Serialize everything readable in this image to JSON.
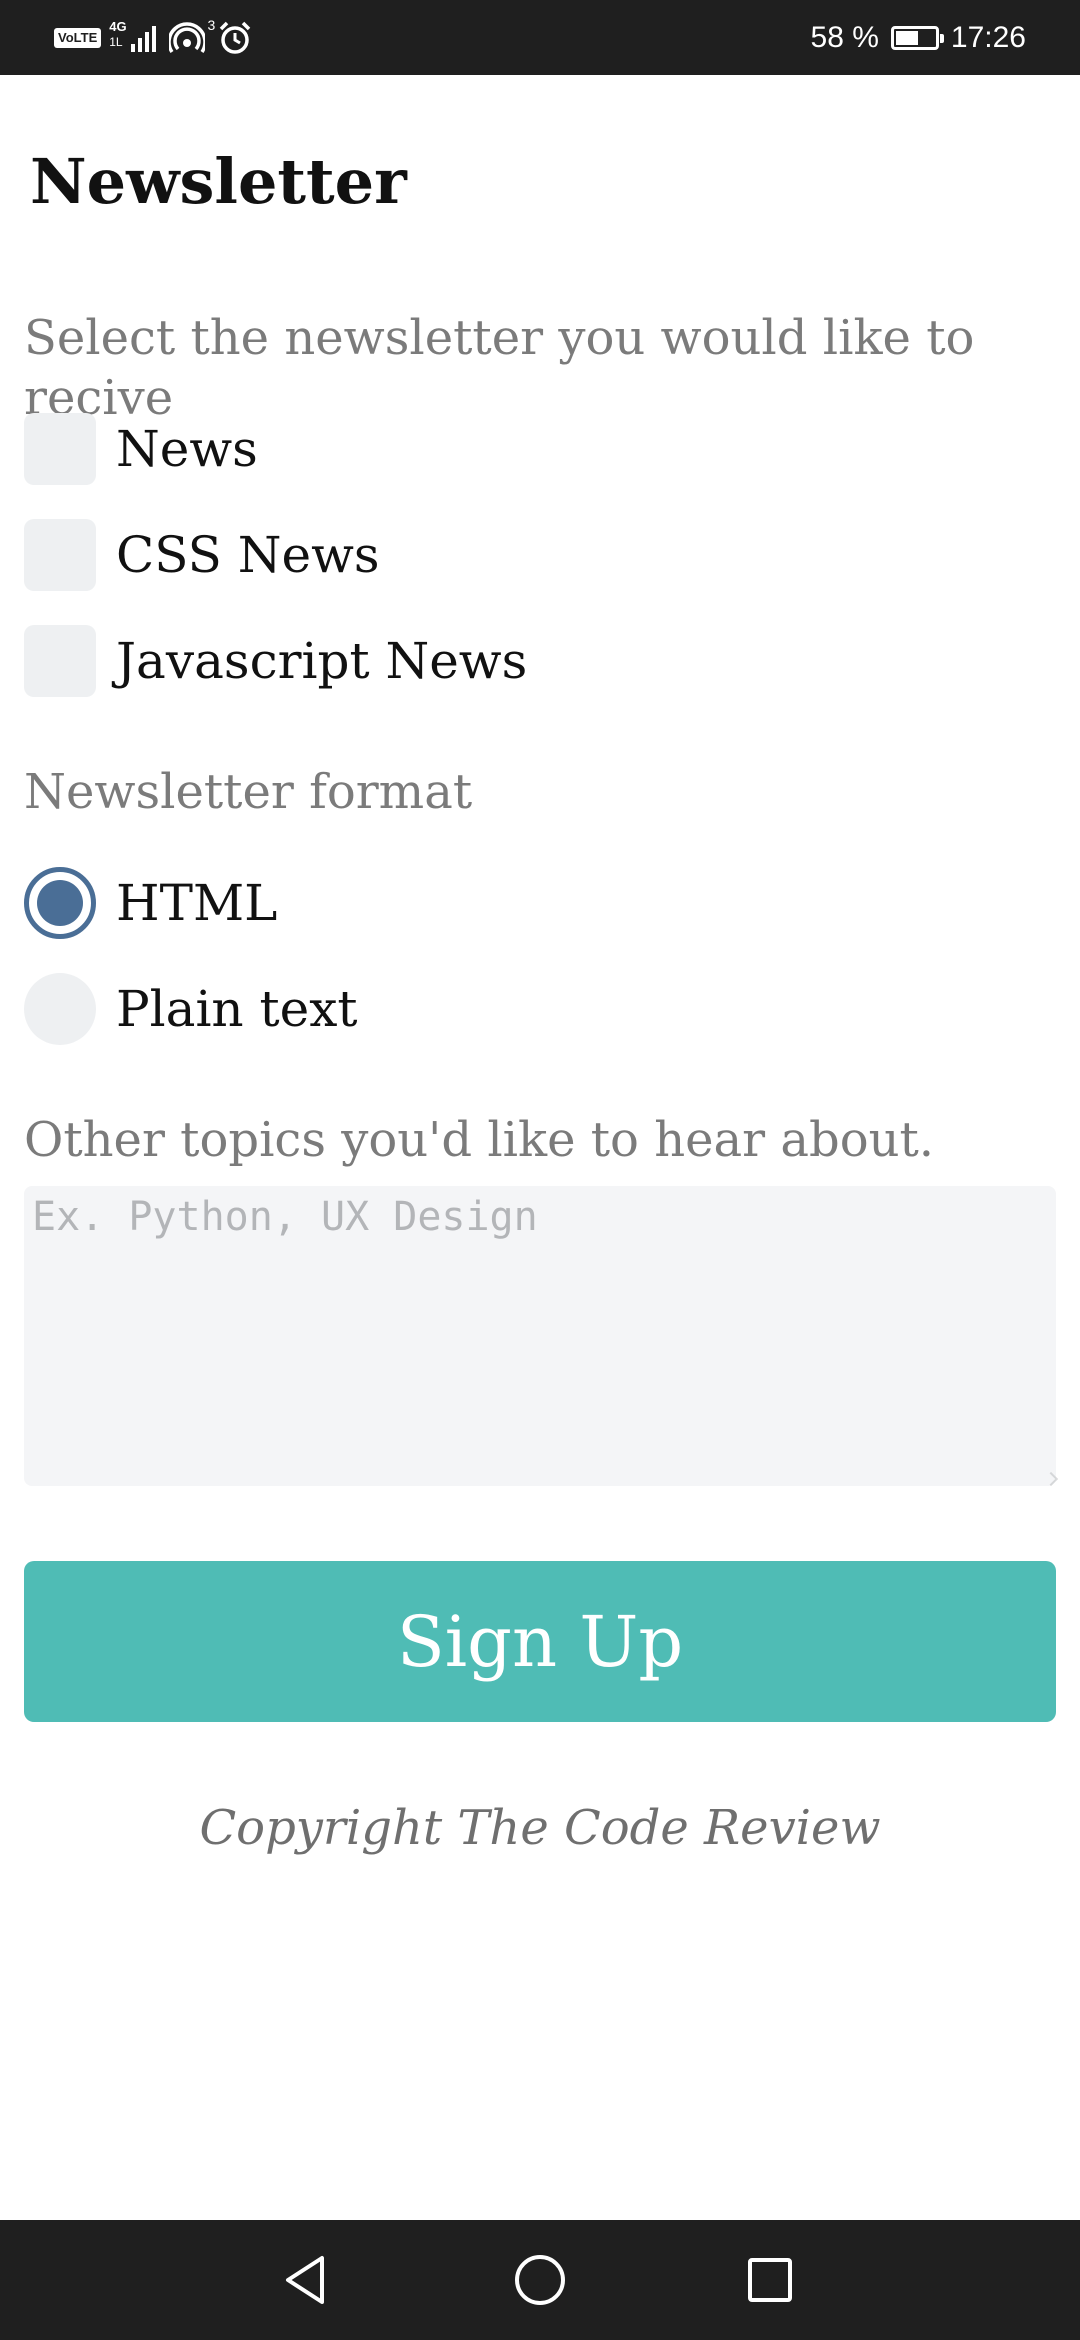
{
  "status_bar": {
    "network_badge": "VoLTE",
    "network_type": "4G",
    "network_sub": "1L",
    "hotspot_count": "3",
    "battery": "58 %",
    "time": "17:26",
    "battery_level": 0.58
  },
  "page": {
    "title": "Newsletter"
  },
  "newsletter": {
    "label": "Select the newsletter you would like to recive",
    "options": [
      {
        "label": "News",
        "checked": false
      },
      {
        "label": "CSS News",
        "checked": false
      },
      {
        "label": "Javascript News",
        "checked": false
      }
    ]
  },
  "format": {
    "label": "Newsletter format",
    "options": [
      {
        "label": "HTML",
        "selected": true
      },
      {
        "label": "Plain text",
        "selected": false
      }
    ]
  },
  "topics": {
    "label": "Other topics you'd like to hear about.",
    "placeholder": "Ex. Python, UX Design",
    "value": ""
  },
  "signup_button": {
    "label": "Sign Up",
    "color": "#4fbcb5"
  },
  "footer": {
    "copyright": "Copyright The Code Review"
  },
  "nav_bar": {
    "icons": [
      "back-icon",
      "home-icon",
      "recents-icon"
    ]
  },
  "colors": {
    "accent": "#4fbcb5",
    "radio_selected": "#4a6e96",
    "control_bg": "#eef0f2"
  }
}
